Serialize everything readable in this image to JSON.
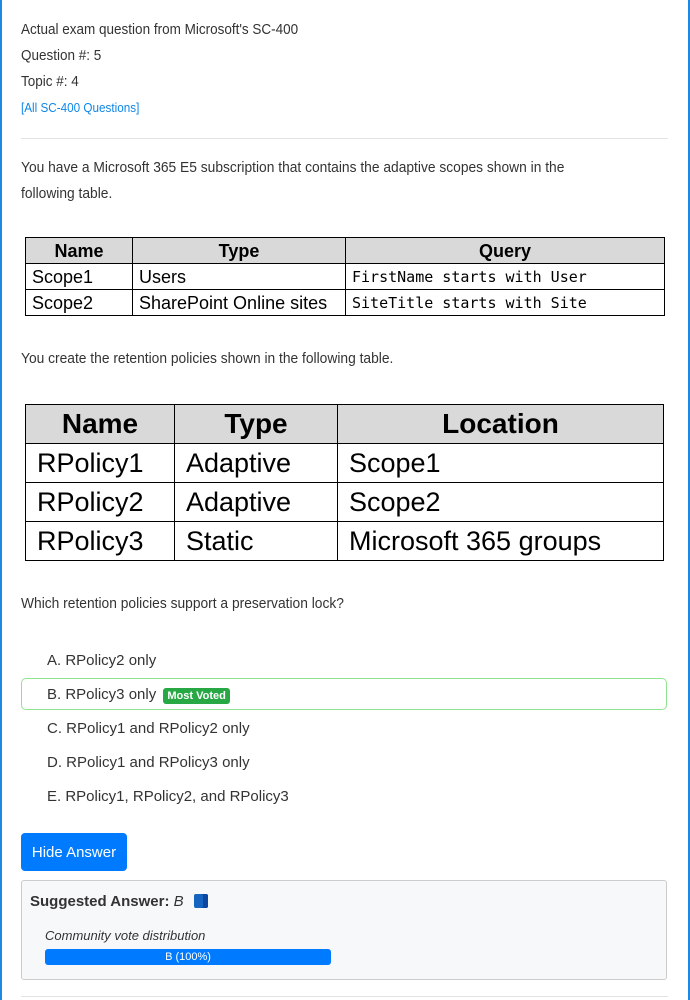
{
  "header": {
    "line1": "Actual exam question from Microsoft's SC-400",
    "question_no": "Question #: 5",
    "topic_no": "Topic #: 4",
    "all_link": "[All SC-400 Questions]"
  },
  "body": {
    "intro": "You have a Microsoft 365 E5 subscription that contains the adaptive scopes shown in the following table.",
    "intro2": "You create the retention policies shown in the following table.",
    "question": "Which retention policies support a preservation lock?"
  },
  "table1": {
    "headers": [
      "Name",
      "Type",
      "Query"
    ],
    "rows": [
      [
        "Scope1",
        "Users",
        "FirstName starts with User"
      ],
      [
        "Scope2",
        "SharePoint Online sites",
        "SiteTitle starts with Site"
      ]
    ]
  },
  "table2": {
    "headers": [
      "Name",
      "Type",
      "Location"
    ],
    "rows": [
      [
        "RPolicy1",
        "Adaptive",
        "Scope1"
      ],
      [
        "RPolicy2",
        "Adaptive",
        "Scope2"
      ],
      [
        "RPolicy3",
        "Static",
        "Microsoft 365 groups"
      ]
    ]
  },
  "options": [
    {
      "label": "A. RPolicy2 only"
    },
    {
      "label": "B. RPolicy3 only",
      "badge": "Most Voted"
    },
    {
      "label": "C. RPolicy1 and RPolicy2 only"
    },
    {
      "label": "D. RPolicy1 and RPolicy3 only"
    },
    {
      "label": "E. RPolicy1, RPolicy2, and RPolicy3"
    }
  ],
  "answer": {
    "button": "Hide Answer",
    "suggested_label": "Suggested Answer:",
    "suggested_value": "B",
    "community_label": "Community vote distribution",
    "vote_bar": "B (100%)",
    "vote_percent": 100
  }
}
